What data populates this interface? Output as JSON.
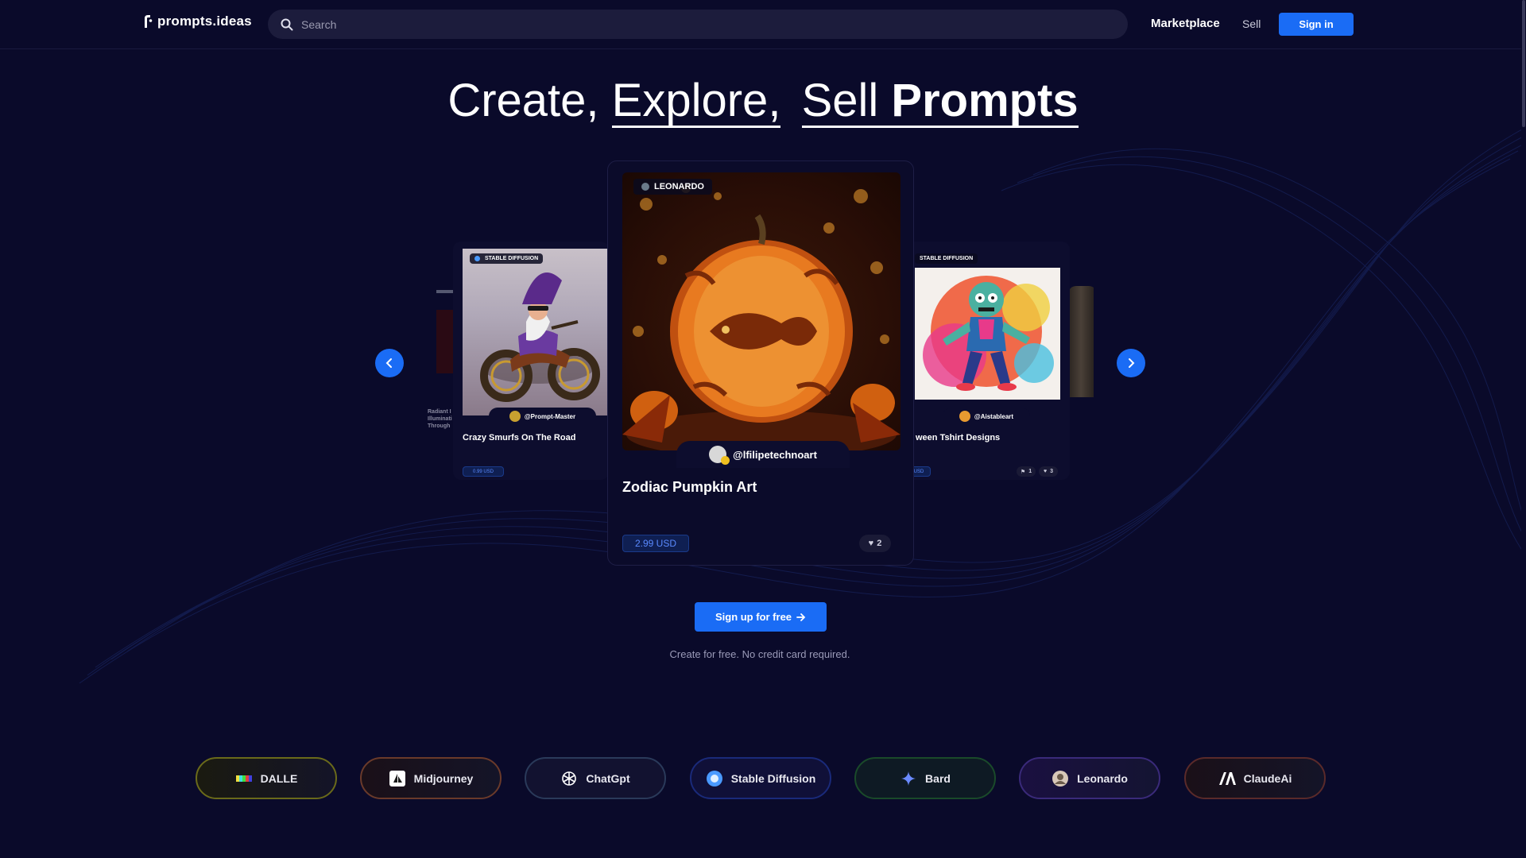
{
  "header": {
    "logo_text": "prompts.ideas",
    "search_placeholder": "Search",
    "nav_marketplace": "Marketplace",
    "nav_sell": "Sell",
    "signin_label": "Sign in"
  },
  "hero": {
    "word1": "Create,",
    "word2": "Explore,",
    "word3": "Sell",
    "word4": "Prompts"
  },
  "carousel": {
    "far_left_card": {
      "title_lines": [
        "Radiant I",
        "Illuminati",
        "Through"
      ]
    },
    "left_card": {
      "tag": "STABLE DIFFUSION",
      "author": "@Prompt-Master",
      "title": "Crazy Smurfs On The Road",
      "price": "0.99 USD"
    },
    "center_card": {
      "tag": "LEONARDO",
      "author": "@lfilipetechnoart",
      "title": "Zodiac Pumpkin Art",
      "price": "2.99 USD",
      "likes": "2"
    },
    "right_card": {
      "tag": "STABLE DIFFUSION",
      "author": "@Aistableart",
      "title": "ween Tshirt Designs",
      "price": "USD",
      "views": "1",
      "likes": "3"
    }
  },
  "cta": {
    "label": "Sign up for free",
    "note": "Create for free. No credit card required."
  },
  "models": [
    {
      "label": "DALLE",
      "icon": "dalle-icon",
      "border": "#6a6a1a"
    },
    {
      "label": "Midjourney",
      "icon": "midjourney-icon",
      "border": "#6a3a2a"
    },
    {
      "label": "ChatGpt",
      "icon": "openai-icon",
      "border": "#2a3a5a"
    },
    {
      "label": "Stable Diffusion",
      "icon": "stable-diffusion-icon",
      "border": "#1a2a7a"
    },
    {
      "label": "Bard",
      "icon": "bard-sparkle-icon",
      "border": "#1a4a2a"
    },
    {
      "label": "Leonardo",
      "icon": "leonardo-icon",
      "border": "#3a2a7a"
    },
    {
      "label": "ClaudeAi",
      "icon": "anthropic-icon",
      "border": "#5a2a2a"
    }
  ],
  "colors": {
    "background": "#0a0a2a",
    "accent": "#1a6cf5"
  }
}
